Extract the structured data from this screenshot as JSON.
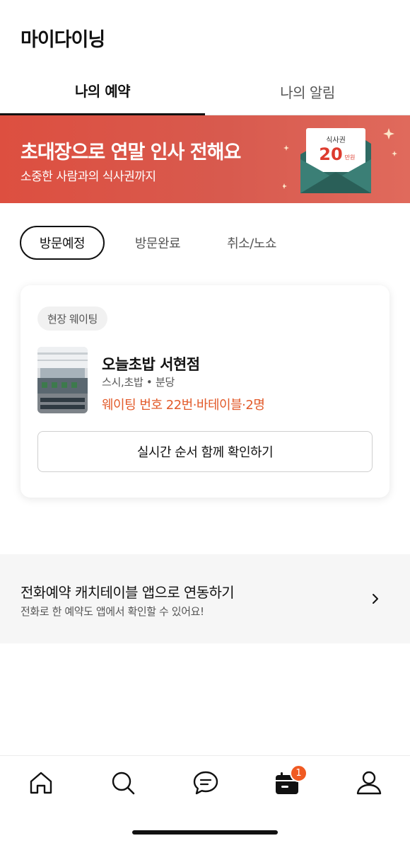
{
  "page": {
    "title": "마이다이닝"
  },
  "tabs": [
    {
      "label": "나의 예약",
      "active": true
    },
    {
      "label": "나의 알림",
      "active": false
    }
  ],
  "banner": {
    "title": "초대장으로 연말 인사 전해요",
    "subtitle": "소중한 사람과의 식사권까지",
    "ticket_label": "식사권",
    "ticket_amount": "20",
    "ticket_unit": "만원"
  },
  "filters": [
    {
      "label": "방문예정",
      "active": true
    },
    {
      "label": "방문완료",
      "active": false
    },
    {
      "label": "취소/노쇼",
      "active": false
    }
  ],
  "reservation": {
    "badge": "현장 웨이팅",
    "store_name": "오늘초밥 서현점",
    "category": "스시,초밥 • 분당",
    "waiting_info": "웨이팅 번호 22번·바테이블·2명",
    "button_label": "실시간 순서 함께 확인하기"
  },
  "link_row": {
    "title": "전화예약 캐치테이블 앱으로 연동하기",
    "subtitle": "전화로 한 예약도 앱에서 확인할 수 있어요!"
  },
  "bottom_nav": {
    "items": [
      "home-icon",
      "search-icon",
      "chat-icon",
      "calendar-icon",
      "profile-icon"
    ],
    "notification_count": "1"
  },
  "colors": {
    "banner": "#dd4f40",
    "accent_orange": "#e25a2a",
    "badge_red": "#f05a22"
  }
}
